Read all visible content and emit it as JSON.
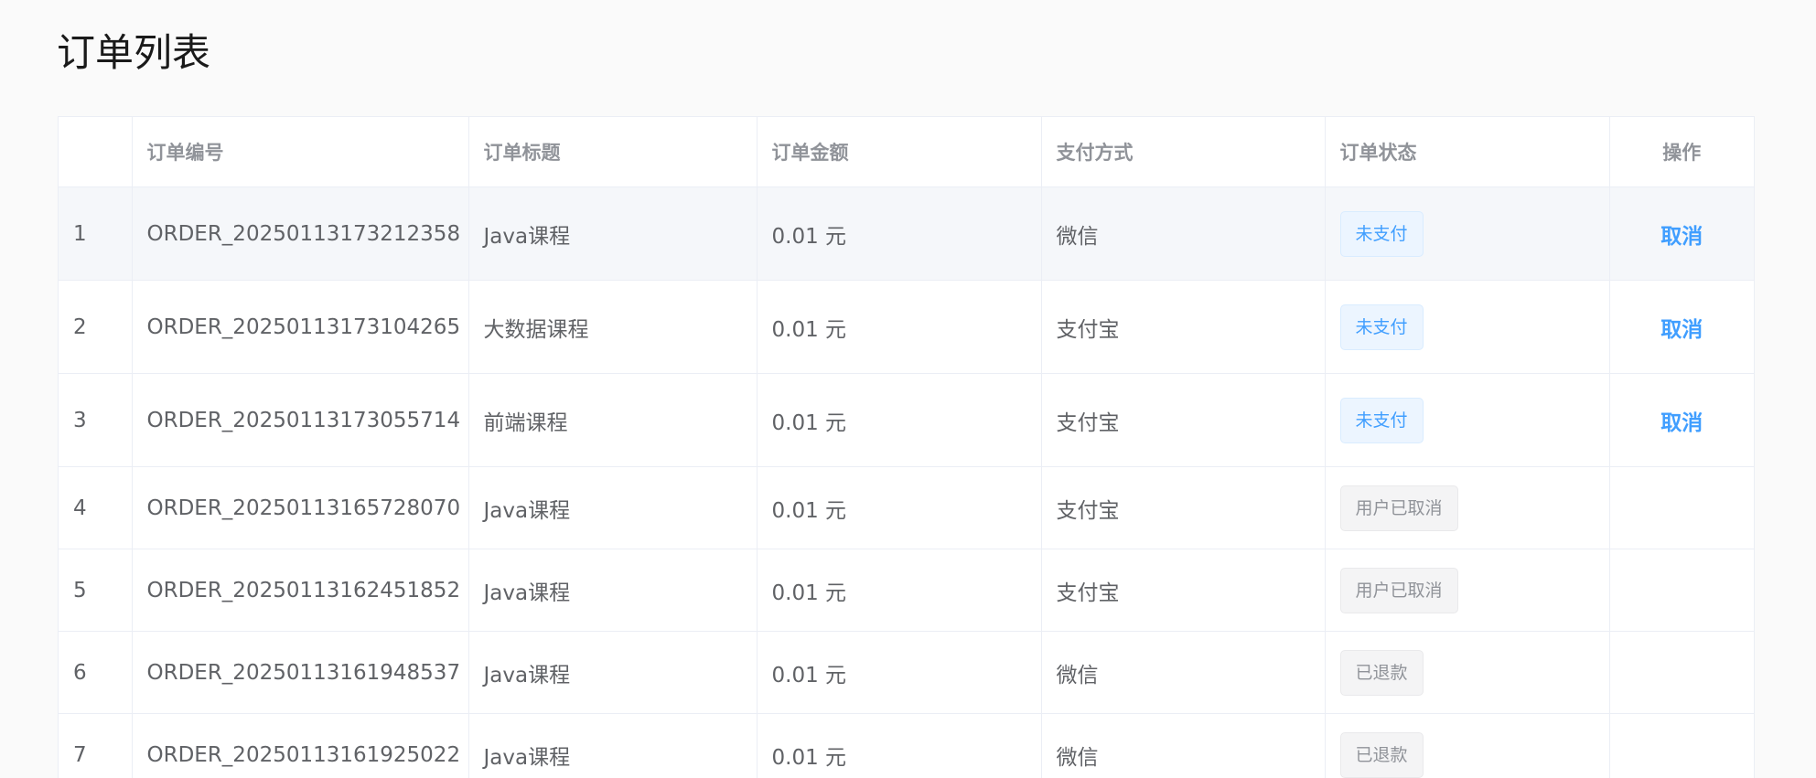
{
  "page": {
    "title": "订单列表"
  },
  "table": {
    "columns": [
      "",
      "订单编号",
      "订单标题",
      "订单金额",
      "支付方式",
      "订单状态",
      "操作"
    ],
    "rows": [
      {
        "index": "1",
        "order_no": "ORDER_20250113173212358",
        "title": "Java课程",
        "amount": "0.01 元",
        "pay_type": "微信",
        "status": "未支付",
        "action": "取消"
      },
      {
        "index": "2",
        "order_no": "ORDER_20250113173104265",
        "title": "大数据课程",
        "amount": "0.01 元",
        "pay_type": "支付宝",
        "status": "未支付",
        "action": "取消"
      },
      {
        "index": "3",
        "order_no": "ORDER_20250113173055714",
        "title": "前端课程",
        "amount": "0.01 元",
        "pay_type": "支付宝",
        "status": "未支付",
        "action": "取消"
      },
      {
        "index": "4",
        "order_no": "ORDER_20250113165728070",
        "title": "Java课程",
        "amount": "0.01 元",
        "pay_type": "支付宝",
        "status": "用户已取消",
        "action": ""
      },
      {
        "index": "5",
        "order_no": "ORDER_20250113162451852",
        "title": "Java课程",
        "amount": "0.01 元",
        "pay_type": "支付宝",
        "status": "用户已取消",
        "action": ""
      },
      {
        "index": "6",
        "order_no": "ORDER_20250113161948537",
        "title": "Java课程",
        "amount": "0.01 元",
        "pay_type": "微信",
        "status": "已退款",
        "action": ""
      },
      {
        "index": "7",
        "order_no": "ORDER_20250113161925022",
        "title": "Java课程",
        "amount": "0.01 元",
        "pay_type": "微信",
        "status": "已退款",
        "action": ""
      }
    ]
  },
  "colors": {
    "accent": "#409eff",
    "unpaid_tag_bg": "#ecf5ff",
    "info_tag_bg": "#f4f4f5",
    "header_text": "#909399",
    "cell_text": "#606266"
  }
}
